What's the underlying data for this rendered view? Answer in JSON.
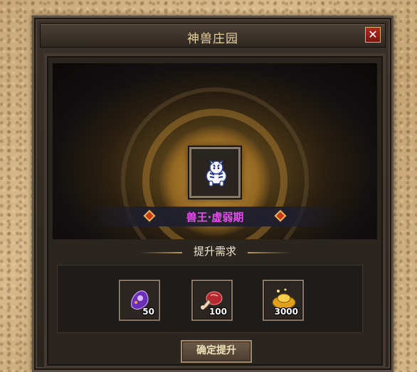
{
  "window": {
    "title": "神兽庄园",
    "close_label": "✕"
  },
  "pet": {
    "name": "兽王·虚弱期",
    "name_color": "#e94cf0",
    "icon": "white-tiger-icon"
  },
  "requirements": {
    "title": "提升需求",
    "items": [
      {
        "icon": "purple-gem-icon",
        "quantity": "50"
      },
      {
        "icon": "red-meat-icon",
        "quantity": "100"
      },
      {
        "icon": "gold-ingot-icon",
        "quantity": "3000"
      }
    ]
  },
  "actions": {
    "confirm_label": "确定提升"
  }
}
